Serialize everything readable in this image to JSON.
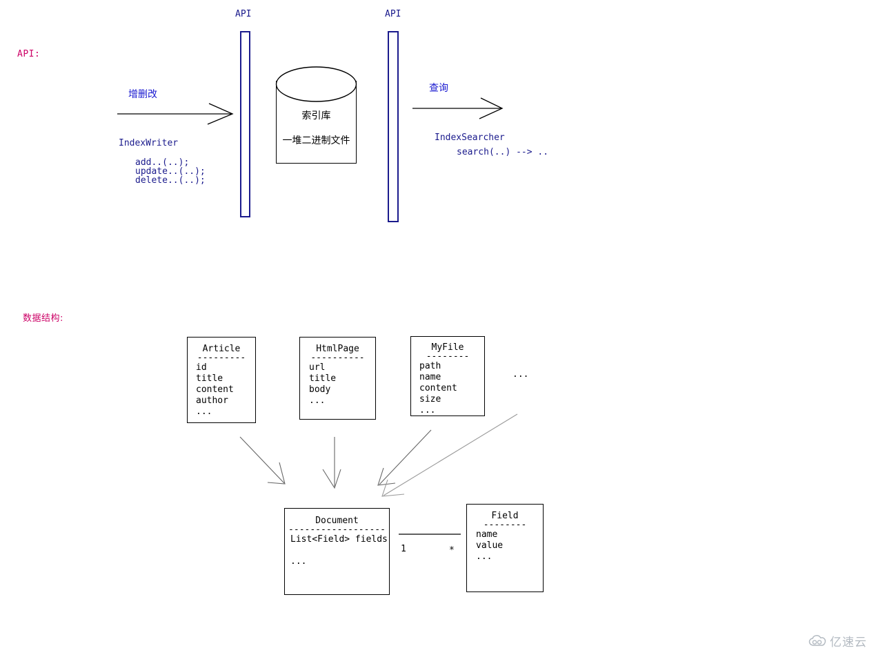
{
  "sections": {
    "api_label": "API:",
    "data_structure_label": "数据结构:"
  },
  "colors": {
    "section_label": "#cc0066",
    "api_blue": "#1a1a8c",
    "annotation_blue": "#1a1ad0",
    "line_black": "#000000",
    "watermark_gray": "#9aa3ad"
  },
  "api_flow": {
    "left_bar_label": "API",
    "right_bar_label": "API",
    "write_arrow_label": "增删改",
    "write_class": "IndexWriter",
    "write_methods": "add..(..);\nupdate..(..);\ndelete..(..);",
    "search_arrow_label": "查询",
    "search_class": "IndexSearcher",
    "search_methods": "search(..) --> ..",
    "store": {
      "title": "索引库",
      "subtitle": "一堆二进制文件"
    }
  },
  "uml": {
    "classes": [
      {
        "name": "Article",
        "separator": "---------",
        "attributes": "id\ntitle\ncontent\nauthor\n..."
      },
      {
        "name": "HtmlPage",
        "separator": "----------",
        "attributes": "url\ntitle\nbody\n..."
      },
      {
        "name": "MyFile",
        "separator": "--------",
        "attributes": "path\nname\ncontent\nsize\n..."
      }
    ],
    "ellipsis": "...",
    "document": {
      "name": "Document",
      "separator": "------------------",
      "attributes": "List<Field> fields\n\n..."
    },
    "field": {
      "name": "Field",
      "separator": "--------",
      "attributes": "name\nvalue\n..."
    },
    "assoc_left_mult": "1",
    "assoc_right_mult": "*"
  },
  "watermark": {
    "text": "亿速云",
    "icon": "cloud-icon"
  }
}
